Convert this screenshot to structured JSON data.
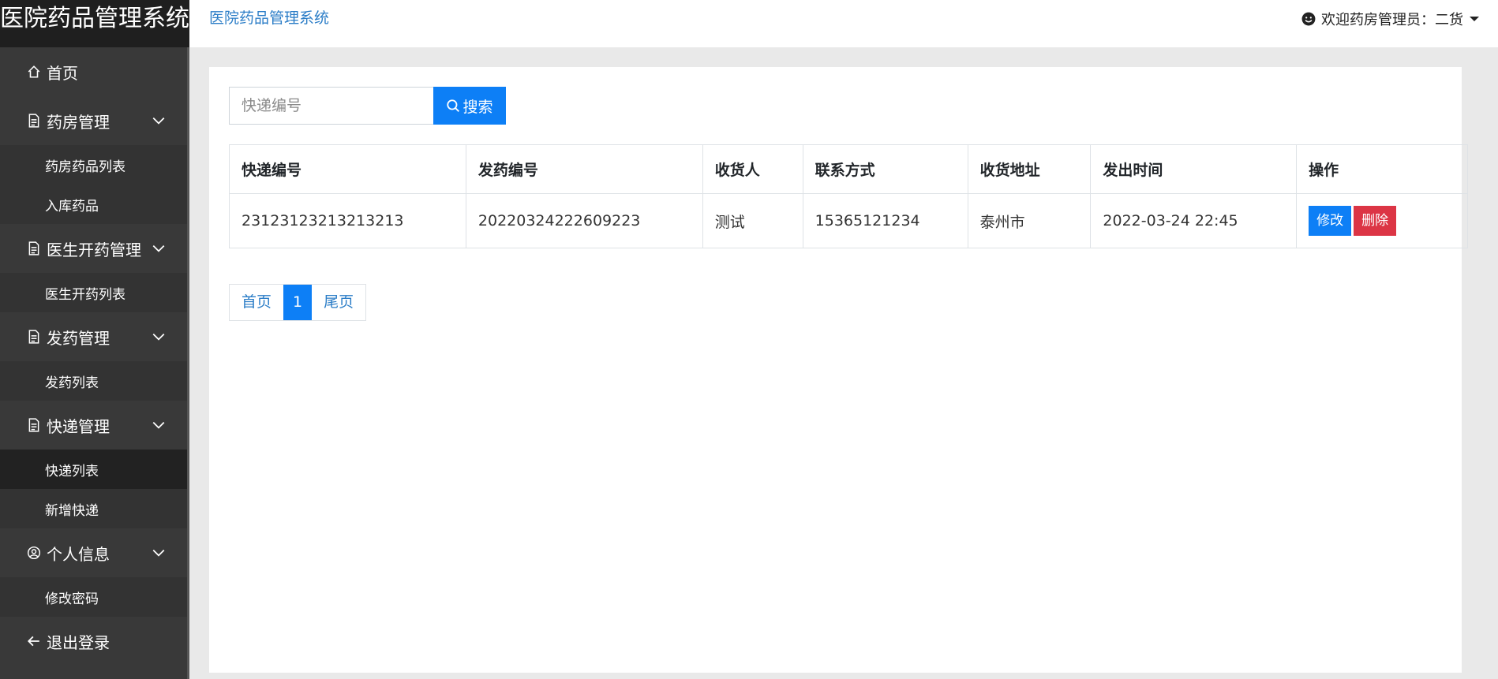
{
  "app": {
    "title": "医院药品管理系统"
  },
  "topbar": {
    "title": "医院药品管理系统",
    "user_greeting": "欢迎药房管理员：二货"
  },
  "sidebar": {
    "home": "首页",
    "groups": [
      {
        "label": "药房管理",
        "icon": "file-icon",
        "items": [
          "药房药品列表",
          "入库药品"
        ]
      },
      {
        "label": "医生开药管理",
        "icon": "file-icon",
        "items": [
          "医生开药列表"
        ]
      },
      {
        "label": "发药管理",
        "icon": "file-icon",
        "items": [
          "发药列表"
        ]
      },
      {
        "label": "快递管理",
        "icon": "file-icon",
        "items": [
          "快递列表",
          "新增快递"
        ]
      },
      {
        "label": "个人信息",
        "icon": "user-circle-icon",
        "items": [
          "修改密码"
        ]
      }
    ],
    "active_item": "快递列表",
    "logout": "退出登录"
  },
  "search": {
    "placeholder": "快递编号",
    "button_label": "搜索"
  },
  "table": {
    "headers": [
      "快递编号",
      "发药编号",
      "收货人",
      "联系方式",
      "收货地址",
      "发出时间",
      "操作"
    ],
    "rows": [
      [
        "23123123213213213",
        "20220324222609223",
        "测试",
        "15365121234",
        "泰州市",
        "2022-03-24 22:45"
      ]
    ],
    "edit_label": "修改",
    "delete_label": "删除"
  },
  "pagination": {
    "first": "首页",
    "current": "1",
    "last": "尾页"
  },
  "colors": {
    "sidebar_bg": "#393939",
    "brand_bg": "#1f1f1f",
    "primary": "#0d7ff6",
    "danger": "#dc3545",
    "link": "#2b7dc7"
  }
}
